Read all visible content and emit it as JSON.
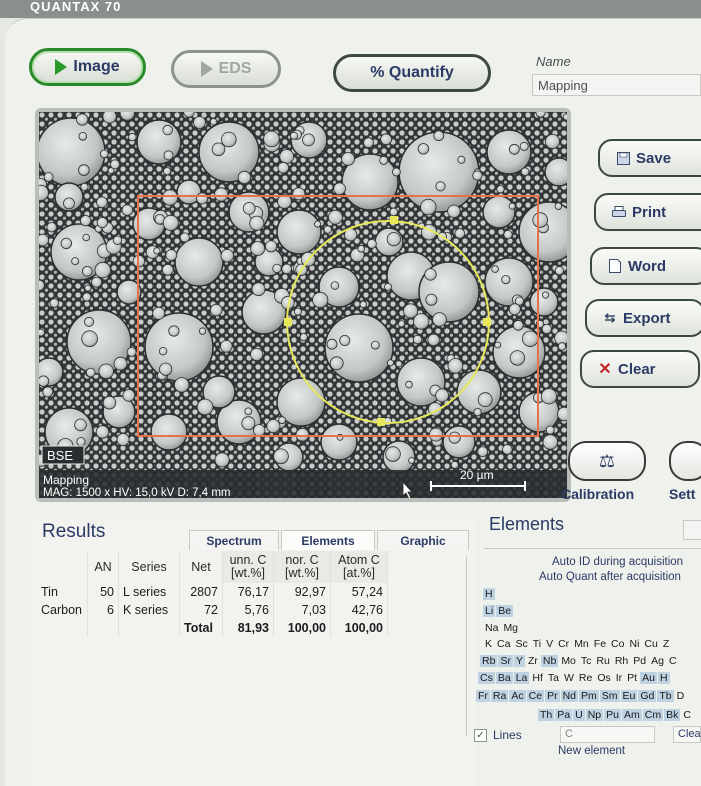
{
  "window": {
    "title": "QUANTAX 70"
  },
  "modes": {
    "image": "Image",
    "eds": "EDS",
    "quantify": "% Quantify"
  },
  "name_field": {
    "label": "Name",
    "value": "Mapping"
  },
  "image_panel": {
    "detector": "BSE",
    "label": "Mapping",
    "info": "MAG: 1500 x  HV: 15,0 kV  D: 7,4 mm",
    "scale_bar": "20 µm"
  },
  "side_buttons": {
    "save": "Save",
    "print": "Print",
    "word": "Word",
    "export": "Export",
    "clear": "Clear"
  },
  "tool_buttons": {
    "calibration": "Calibration",
    "settings": "Sett"
  },
  "results": {
    "title": "Results",
    "tabs": [
      "Spectrum",
      "Elements",
      "Graphic"
    ],
    "active_tab": "Elements",
    "headers": {
      "an": "AN",
      "series": "Series",
      "net": "Net",
      "unn_c": "unn. C",
      "unn_unit": "[wt.%]",
      "nor_c": "nor. C",
      "nor_unit": "[wt.%]",
      "atom_c": "Atom C",
      "atom_unit": "[at.%]"
    },
    "rows": [
      {
        "element": "Tin",
        "an": "50",
        "series": "L series",
        "net": "2807",
        "unn": "76,17",
        "nor": "92,97",
        "atom": "57,24"
      },
      {
        "element": "Carbon",
        "an": "6",
        "series": "K series",
        "net": "72",
        "unn": "5,76",
        "nor": "7,03",
        "atom": "42,76"
      }
    ],
    "total": {
      "label": "Total",
      "unn": "81,93",
      "nor": "100,00",
      "atom": "100,00"
    }
  },
  "elements": {
    "title": "Elements",
    "auto_id": "Auto ID during acquisition",
    "auto_quant": "Auto Quant after acquisition",
    "lines_label": "Lines",
    "input_value": "C",
    "clear_label": "Clea",
    "new_element": "New element",
    "periodic_rows": [
      [
        "H"
      ],
      [
        "Li",
        "Be"
      ],
      [
        "Na",
        "Mg"
      ],
      [
        "K",
        "Ca",
        "Sc",
        "Ti",
        "V",
        "Cr",
        "Mn",
        "Fe",
        "Co",
        "Ni",
        "Cu",
        "Z"
      ],
      [
        "Rb",
        "Sr",
        "Y",
        "Zr",
        "Nb",
        "Mo",
        "Tc",
        "Ru",
        "Rh",
        "Pd",
        "Ag",
        "C"
      ],
      [
        "Cs",
        "Ba",
        "La",
        "Hf",
        "Ta",
        "W",
        "Re",
        "Os",
        "Ir",
        "Pt",
        "Au",
        "H"
      ],
      [
        "Fr",
        "Ra",
        "Ac",
        "Ce",
        "Pr",
        "Nd",
        "Pm",
        "Sm",
        "Eu",
        "Gd",
        "Tb",
        "D"
      ],
      [
        "Th",
        "Pa",
        "U",
        "Np",
        "Pu",
        "Am",
        "Cm",
        "Bk",
        "C"
      ]
    ],
    "highlighted": [
      "H",
      "Li",
      "Be",
      "Rb",
      "Sr",
      "Y",
      "Nb",
      "Cs",
      "Ba",
      "La",
      "Au",
      "Fr",
      "Ra",
      "Ac",
      "Ce",
      "Pr",
      "Nd",
      "Pm",
      "Sm",
      "Eu",
      "Gd",
      "Tb",
      "Th",
      "Pa",
      "U",
      "Np",
      "Pu",
      "Am",
      "Cm",
      "Bk"
    ]
  },
  "colors": {
    "accent": "#2c3a66",
    "roi_rectangle": "#e8704a",
    "roi_circle": "#e6e85a",
    "active_green": "#2a8a2a",
    "clear_x": "#c0282a"
  }
}
